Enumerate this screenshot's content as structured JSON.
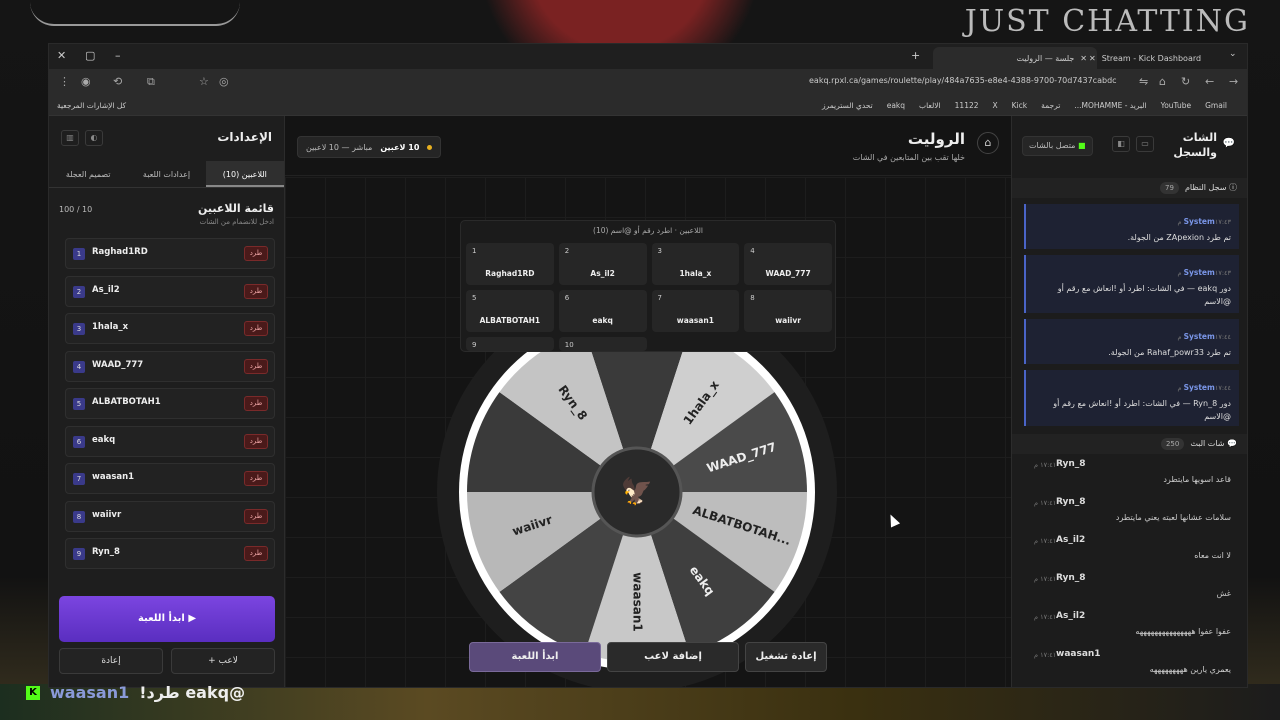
{
  "stream_overlay": {
    "title": "JUST CHATTING",
    "alert_user": "waasan1",
    "alert_text": "@eakq طرد!"
  },
  "browser": {
    "tabs": [
      {
        "label": "جلسة — الروليت",
        "active": true
      },
      {
        "label": "Stream - Kick Dashboard",
        "active": false
      }
    ],
    "url": "eakq.rpxl.ca/games/roulette/play/484a7635-e8e4-4388-9700-70d7437cabdc",
    "bookmarks": [
      "Gmail",
      "YouTube",
      "البريد - MOHAMME...",
      "ترجمة",
      "Kick",
      "X",
      "11122",
      "الالعاب",
      "eakq",
      "تحدي الستريمرز"
    ],
    "bookmarks_left": "كل الإشارات المرجعية"
  },
  "settings": {
    "title": "الإعدادات",
    "tabs": [
      "اللاعبين (10)",
      "إعدادات اللعبة",
      "تصميم العجلة"
    ],
    "list_title": "قائمة اللاعبين",
    "list_sub": "ادخل للانضمام من الشات",
    "count": "100 / 10",
    "kick_label": "طرد",
    "players": [
      {
        "n": "1",
        "name": "Raghad1RD"
      },
      {
        "n": "2",
        "name": "As_il2"
      },
      {
        "n": "3",
        "name": "1hala_x"
      },
      {
        "n": "4",
        "name": "WAAD_777"
      },
      {
        "n": "5",
        "name": "ALBATBOTAH1"
      },
      {
        "n": "6",
        "name": "eakq"
      },
      {
        "n": "7",
        "name": "waasan1"
      },
      {
        "n": "8",
        "name": "waiivr"
      },
      {
        "n": "9",
        "name": "Ryn_8"
      }
    ],
    "start": "ابدأ اللعبة ▶",
    "add_player": "+ لاعب",
    "reset": "إعادة"
  },
  "game": {
    "title": "الروليت",
    "subtitle": "خلها تقب بين المتابعين في الشات",
    "players_badge": "10 لاعبين",
    "live_text": "مباشر — 10 لاعبين",
    "overlay_title": "اللاعبين · اطرد رقم أو @اسم (10)",
    "cells": [
      {
        "n": "1",
        "name": "Raghad1RD"
      },
      {
        "n": "2",
        "name": "As_il2"
      },
      {
        "n": "3",
        "name": "1hala_x"
      },
      {
        "n": "4",
        "name": "WAAD_777"
      },
      {
        "n": "5",
        "name": "ALBATBOTAH1"
      },
      {
        "n": "6",
        "name": "eakq"
      },
      {
        "n": "7",
        "name": "waasan1"
      },
      {
        "n": "8",
        "name": "waiivr"
      },
      {
        "n": "9",
        "name": ""
      },
      {
        "n": "10",
        "name": ""
      }
    ],
    "wheel_labels": [
      "Ryn_8",
      "1hala_x",
      "WAAD_777",
      "ALBATBOTAH...",
      "eakq",
      "waasan1",
      "waiivr"
    ],
    "btn_restart": "إعادة تشغيل",
    "btn_add": "إضافة لاعب",
    "btn_start": "ابدأ اللعبة"
  },
  "chat": {
    "title": "الشات والسجل",
    "connected": "متصل بالشات",
    "syslog_title": "سجل النظام",
    "syslog_count": "79",
    "system_msgs": [
      {
        "who": "System",
        "time": "١٧:٤٣ م",
        "text": "تم طرد ZApexion من الجولة."
      },
      {
        "who": "System",
        "time": "١٧:٤٣ م",
        "text": "دور eakq — في الشات: اطرد أو !انعاش مع رقم أو @الاسم"
      },
      {
        "who": "System",
        "time": "١٧:٤٤ م",
        "text": "تم طرد Rahaf_powr33 من الجولة."
      },
      {
        "who": "System",
        "time": "١٧:٤٤ م",
        "text": "دور Ryn_8 — في الشات: اطرد أو !انعاش مع رقم أو @الاسم"
      }
    ],
    "live_title": "شات البث",
    "live_count": "250",
    "messages": [
      {
        "user": "Ryn_8",
        "time": "١٧:٤١ م",
        "text": "قاعد اسويها مايتطرد"
      },
      {
        "user": "Ryn_8",
        "time": "١٧:٤١ م",
        "text": "سلامات عشانها لعبته يعني مايتطرد"
      },
      {
        "user": "As_il2",
        "time": "١٧:٤١ م",
        "text": "لا انت معاه"
      },
      {
        "user": "Ryn_8",
        "time": "١٧:٤١ م",
        "text": "غش"
      },
      {
        "user": "As_il2",
        "time": "١٧:٤١ م",
        "text": "عفوا عفوا هههههههههههههههه"
      },
      {
        "user": "waasan1",
        "time": "١٧:٤١ م",
        "text": "يعمري يارين هههههههههه"
      }
    ]
  }
}
